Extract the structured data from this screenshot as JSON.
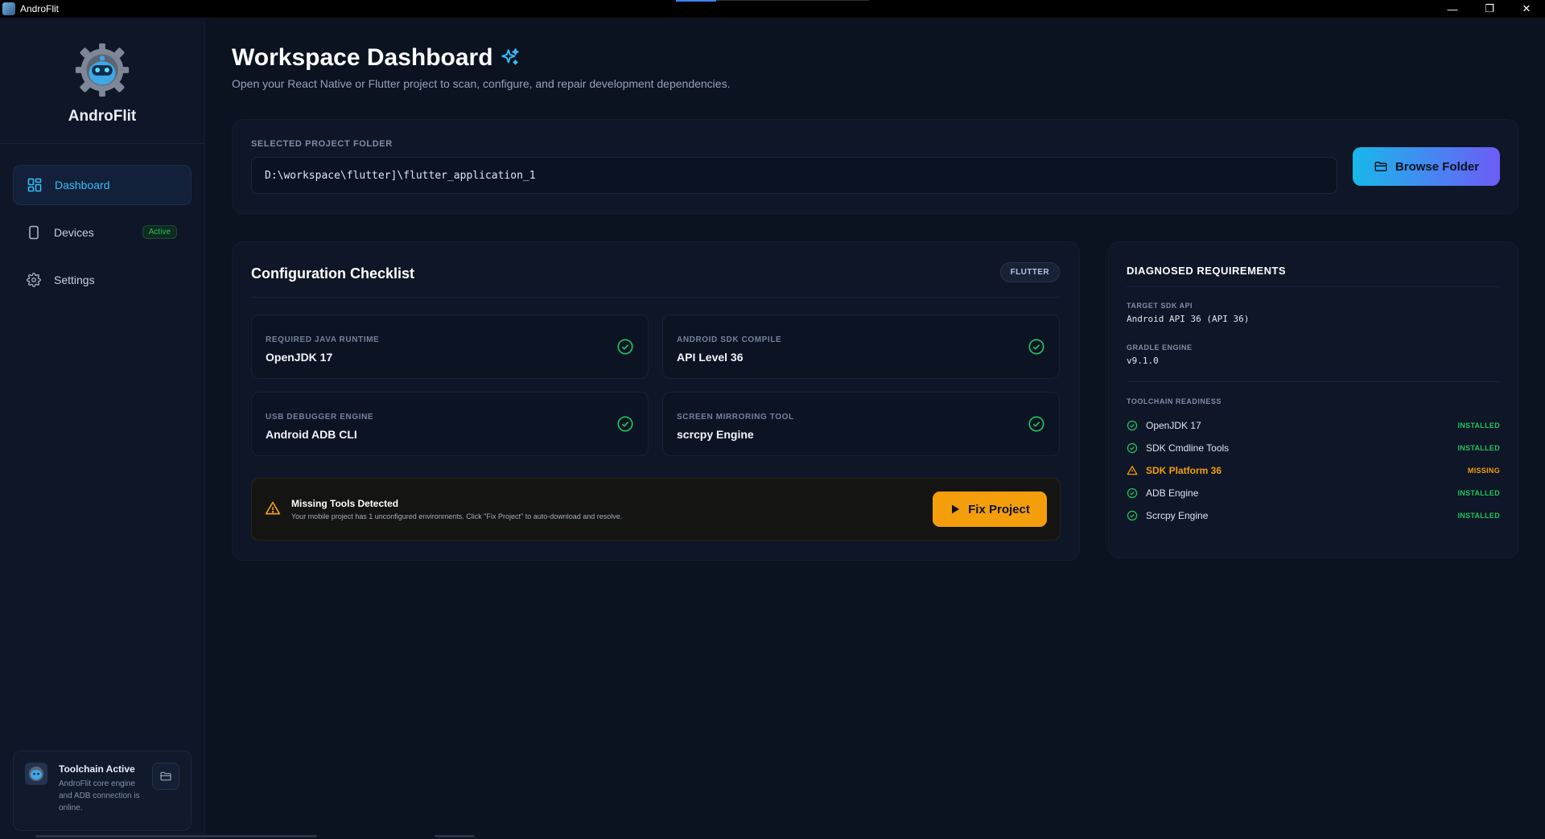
{
  "window": {
    "title": "AndroFlit",
    "minimize_glyph": "—",
    "restore_glyph": "❐",
    "close_glyph": "✕"
  },
  "sidebar": {
    "brand_name": "AndroFlit",
    "items": [
      {
        "label": "Dashboard",
        "icon": "dashboard-grid-icon",
        "active": true
      },
      {
        "label": "Devices",
        "icon": "phone-icon",
        "badge": "Active"
      },
      {
        "label": "Settings",
        "icon": "gear-icon"
      }
    ],
    "toolchain": {
      "title": "Toolchain Active",
      "description": "AndroFlit core engine and ADB connection is online."
    }
  },
  "header": {
    "title": "Workspace Dashboard",
    "subtitle": "Open your React Native or Flutter project to scan, configure, and repair development dependencies."
  },
  "project": {
    "label": "SELECTED PROJECT FOLDER",
    "path": "D:\\workspace\\flutter]\\flutter_application_1",
    "browse_label": "Browse Folder"
  },
  "checklist": {
    "title": "Configuration Checklist",
    "framework_badge": "FLUTTER",
    "items": [
      {
        "label": "REQUIRED JAVA RUNTIME",
        "value": "OpenJDK 17"
      },
      {
        "label": "ANDROID SDK COMPILE",
        "value": "API Level 36"
      },
      {
        "label": "USB DEBUGGER ENGINE",
        "value": "Android ADB CLI"
      },
      {
        "label": "SCREEN MIRRORING TOOL",
        "value": "scrcpy Engine"
      }
    ],
    "alert": {
      "title": "Missing Tools Detected",
      "description": "Your mobile project has 1 unconfigured environments. Click \"Fix Project\" to auto-download and resolve.",
      "fix_label": "Fix Project"
    }
  },
  "requirements": {
    "title": "DIAGNOSED REQUIREMENTS",
    "target_sdk_label": "TARGET SDK API",
    "target_sdk_value": "Android API 36 (API 36)",
    "gradle_label": "GRADLE ENGINE",
    "gradle_value": "v9.1.0",
    "toolchain_label": "TOOLCHAIN READINESS",
    "tools": [
      {
        "name": "OpenJDK 17",
        "status": "INSTALLED"
      },
      {
        "name": "SDK Cmdline Tools",
        "status": "INSTALLED"
      },
      {
        "name": "SDK Platform 36",
        "status": "MISSING"
      },
      {
        "name": "ADB Engine",
        "status": "INSTALLED"
      },
      {
        "name": "Scrcpy Engine",
        "status": "INSTALLED"
      }
    ]
  },
  "colors": {
    "accent": "#38bdf8",
    "success": "#22c55e",
    "warning": "#f59e0b",
    "background": "#0b1220"
  }
}
